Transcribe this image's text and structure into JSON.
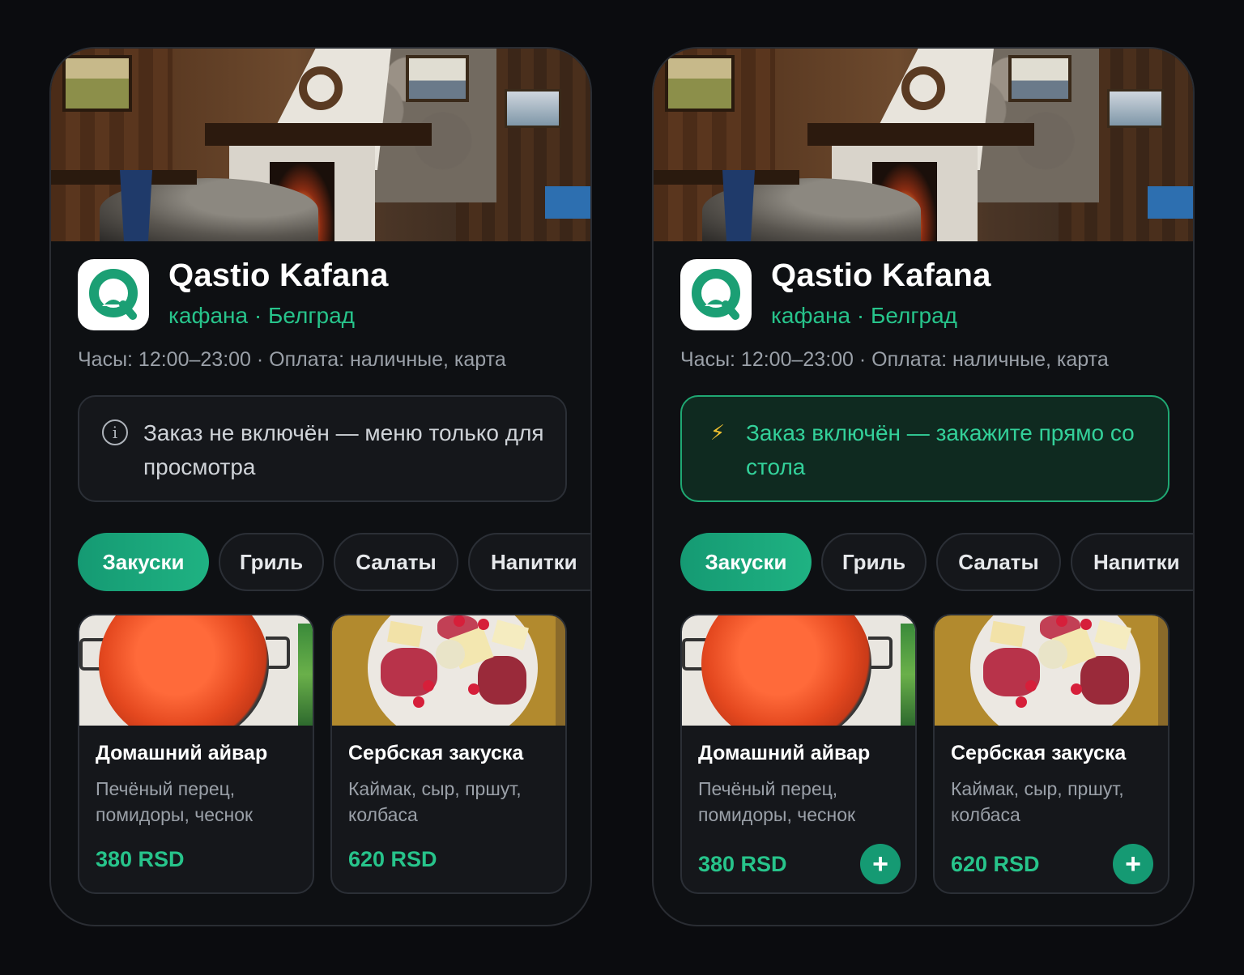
{
  "screens": [
    {
      "variant": "order_disabled",
      "restaurant": {
        "name": "Qastio Kafana",
        "subtitle": "кафана · Белград",
        "meta": "Часы: 12:00–23:00 · Оплата: наличные, карта"
      },
      "banner": {
        "icon": "info-icon",
        "icon_glyph": "i",
        "text": "Заказ не включён — меню только для просмотра"
      },
      "tabs": [
        {
          "label": "Закуски",
          "active": true
        },
        {
          "label": "Гриль",
          "active": false
        },
        {
          "label": "Салаты",
          "active": false
        },
        {
          "label": "Напитки",
          "active": false
        }
      ],
      "items": [
        {
          "name": "Домашний айвар",
          "desc": "Печёный перец, помидоры, чеснок",
          "price": "380 RSD"
        },
        {
          "name": "Сербская закуска",
          "desc": "Каймак, сыр, пршут, колбаса",
          "price": "620 RSD"
        }
      ]
    },
    {
      "variant": "order_enabled",
      "restaurant": {
        "name": "Qastio Kafana",
        "subtitle": "кафана · Белград",
        "meta": "Часы: 12:00–23:00 · Оплата: наличные, карта"
      },
      "banner": {
        "icon": "lightning-icon",
        "icon_glyph": "⚡",
        "text": "Заказ включён — закажите прямо со стола"
      },
      "tabs": [
        {
          "label": "Закуски",
          "active": true
        },
        {
          "label": "Гриль",
          "active": false
        },
        {
          "label": "Салаты",
          "active": false
        },
        {
          "label": "Напитки",
          "active": false
        }
      ],
      "items": [
        {
          "name": "Домашний айвар",
          "desc": "Печёный перец, помидоры, чеснок",
          "price": "380 RSD",
          "add": "+"
        },
        {
          "name": "Сербская закуска",
          "desc": "Каймак, сыр, пршут, колбаса",
          "price": "620 RSD",
          "add": "+"
        }
      ]
    }
  ],
  "colors": {
    "background": "#0b0c0f",
    "card": "#15171b",
    "accent": "#1fb282",
    "accent_text": "#27c48b",
    "banner_on_bg": "#0f2a20",
    "banner_on_text": "#33d19a"
  }
}
